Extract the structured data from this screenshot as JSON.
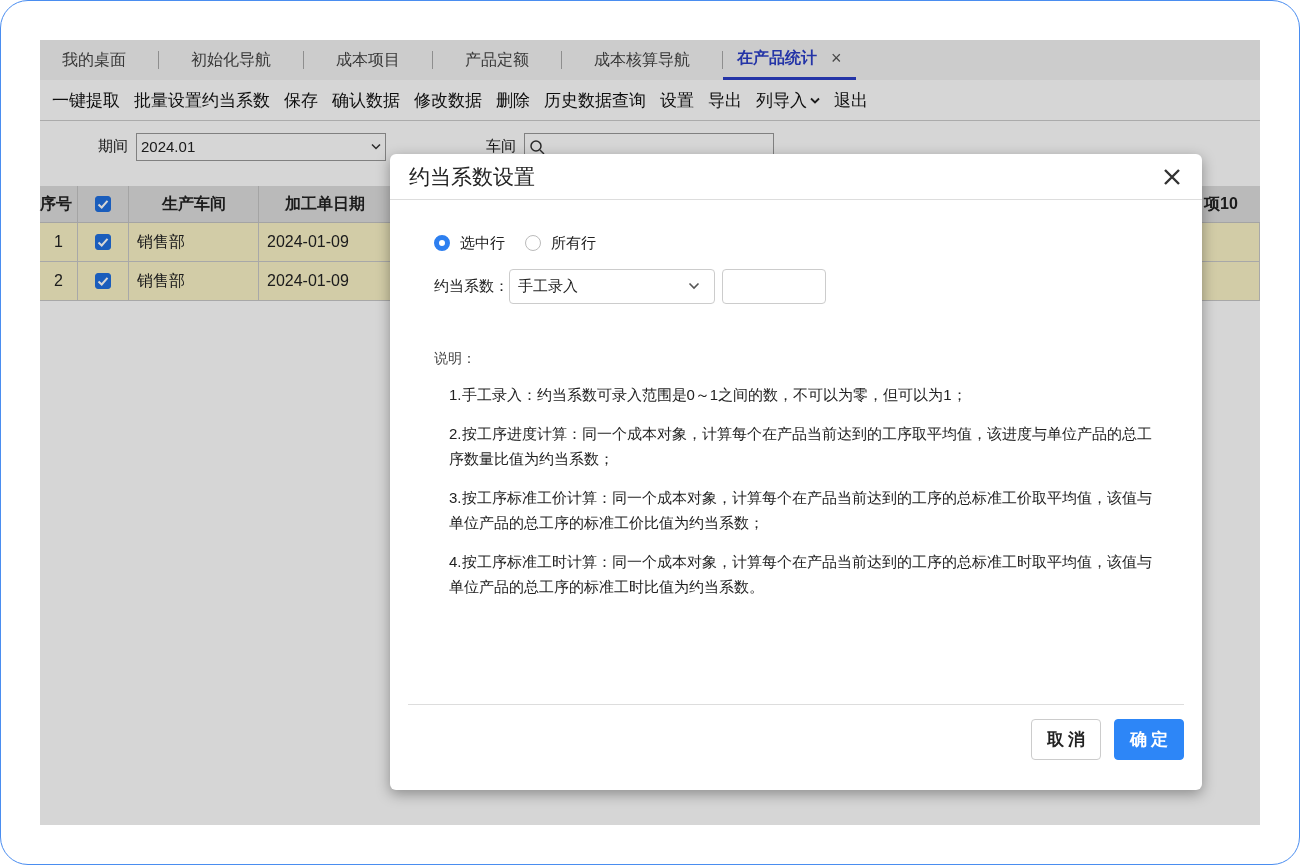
{
  "tabs": [
    {
      "label": "我的桌面",
      "selected": false
    },
    {
      "label": "初始化导航",
      "selected": false
    },
    {
      "label": "成本项目",
      "selected": false
    },
    {
      "label": "产品定额",
      "selected": false
    },
    {
      "label": "成本核算导航",
      "selected": false
    },
    {
      "label": "在产品统计",
      "selected": true,
      "close": "×"
    }
  ],
  "toolbar": [
    {
      "label": "一键提取"
    },
    {
      "label": "批量设置约当系数"
    },
    {
      "label": "保存"
    },
    {
      "label": "确认数据"
    },
    {
      "label": "修改数据"
    },
    {
      "label": "删除"
    },
    {
      "label": "历史数据查询"
    },
    {
      "label": "设置"
    },
    {
      "label": "导出"
    },
    {
      "label": "列导入",
      "menu": true
    },
    {
      "label": "退出"
    }
  ],
  "filters": [
    {
      "label": "期间",
      "value": "2024.01",
      "kind": "dropdown"
    },
    {
      "label": "车间",
      "kind": "search"
    }
  ],
  "table": {
    "columns": [
      {
        "label": "序号"
      },
      {
        "kind": "checkbox",
        "checked": true
      },
      {
        "label": "生产车间"
      },
      {
        "label": "加工单日期"
      },
      {
        "label": "项10"
      }
    ],
    "rows": [
      {
        "index": "1",
        "checked": true,
        "workshop": "销售部",
        "date": "2024-01-09"
      },
      {
        "index": "2",
        "checked": true,
        "workshop": "销售部",
        "date": "2024-01-09"
      }
    ]
  },
  "dialog": {
    "title": "约当系数设置",
    "scope_options": [
      {
        "label": "选中行",
        "selected": true
      },
      {
        "label": "所有行",
        "selected": false
      }
    ],
    "coefficient": {
      "label": "约当系数：",
      "method": "手工录入"
    },
    "notes_title": "说明：",
    "notes": [
      "1.手工录入：约当系数可录入范围是0～1之间的数，不可以为零，但可以为1；",
      "2.按工序进度计算：同一个成本对象，计算每个在产品当前达到的工序取平均值，该进度与单位产品的总工序数量比值为约当系数；",
      "3.按工序标准工价计算：同一个成本对象，计算每个在产品当前达到的工序的总标准工价取平均值，该值与单位产品的总工序的标准工价比值为约当系数；",
      "4.按工序标准工时计算：同一个成本对象，计算每个在产品当前达到的工序的总标准工时取平均值，该值与单位产品的总工序的标准工时比值为约当系数。"
    ],
    "buttons": [
      {
        "label": "取消",
        "kind": "secondary"
      },
      {
        "label": "确定",
        "kind": "primary"
      }
    ]
  }
}
